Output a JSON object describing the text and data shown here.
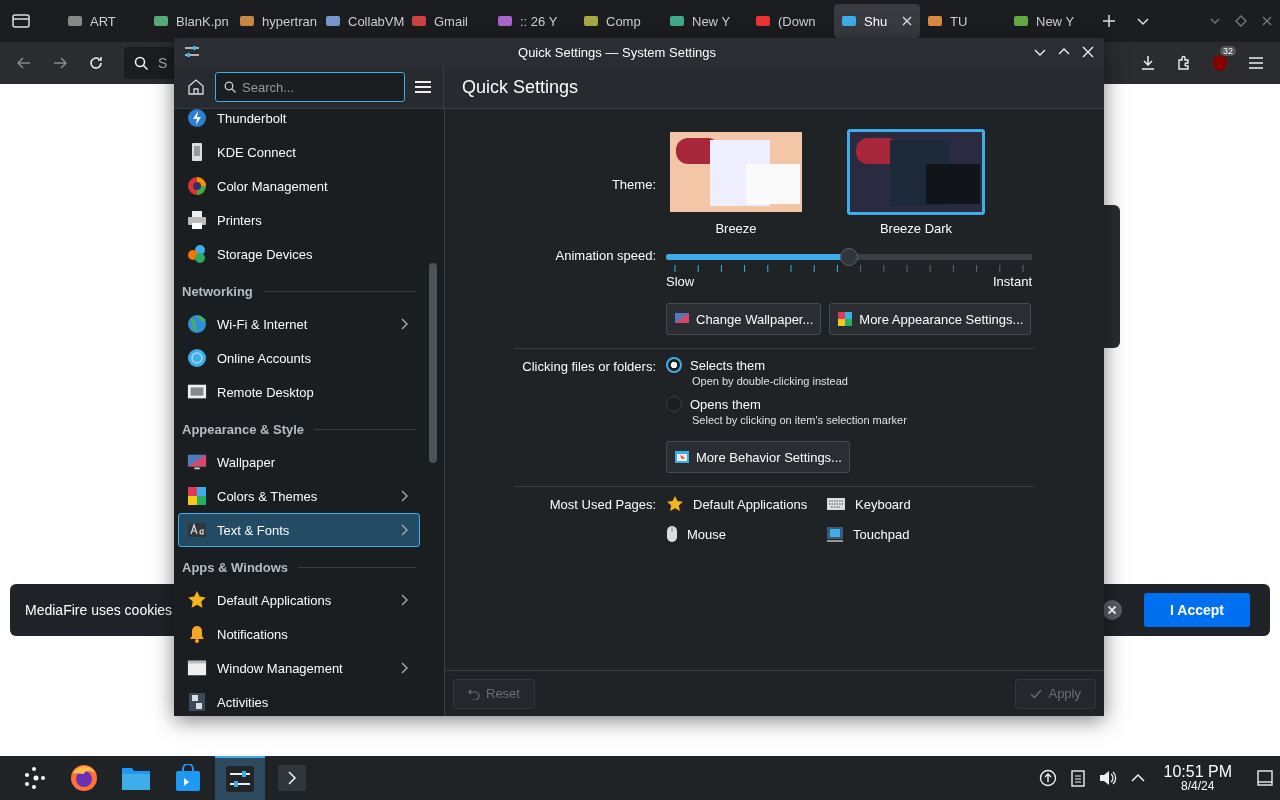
{
  "browser": {
    "tabs": [
      {
        "label": "ART",
        "selected": false
      },
      {
        "label": "BlanK.pn",
        "selected": false
      },
      {
        "label": "hypertran",
        "selected": false
      },
      {
        "label": "CollabVM",
        "selected": false
      },
      {
        "label": "Gmail",
        "selected": false
      },
      {
        "label": ":: 26 Y",
        "selected": false
      },
      {
        "label": "Comp",
        "selected": false
      },
      {
        "label": "New Y",
        "selected": false
      },
      {
        "label": "(Down",
        "selected": false
      },
      {
        "label": "Shu",
        "selected": true
      },
      {
        "label": "TU",
        "selected": false
      },
      {
        "label": "New Y",
        "selected": false
      }
    ],
    "address": {
      "placeholder": "S"
    },
    "extension_badge": "32"
  },
  "page": {
    "cookie_banner": {
      "text": "MediaFire uses cookies",
      "button": "I Accept"
    }
  },
  "window": {
    "title": "Quick Settings — System Settings",
    "search": {
      "placeholder": "Search..."
    },
    "page_title": "Quick Settings",
    "sidebar": {
      "items": [
        {
          "kind": "item",
          "label": "Thunderbolt",
          "arrow": false,
          "selected": false
        },
        {
          "kind": "item",
          "label": "KDE Connect",
          "arrow": false,
          "selected": false
        },
        {
          "kind": "item",
          "label": "Color Management",
          "arrow": false,
          "selected": false
        },
        {
          "kind": "item",
          "label": "Printers",
          "arrow": false,
          "selected": false
        },
        {
          "kind": "item",
          "label": "Storage Devices",
          "arrow": false,
          "selected": false
        },
        {
          "kind": "section",
          "label": "Networking"
        },
        {
          "kind": "item",
          "label": "Wi-Fi & Internet",
          "arrow": true,
          "selected": false
        },
        {
          "kind": "item",
          "label": "Online Accounts",
          "arrow": false,
          "selected": false
        },
        {
          "kind": "item",
          "label": "Remote Desktop",
          "arrow": false,
          "selected": false
        },
        {
          "kind": "section",
          "label": "Appearance & Style"
        },
        {
          "kind": "item",
          "label": "Wallpaper",
          "arrow": false,
          "selected": false
        },
        {
          "kind": "item",
          "label": "Colors & Themes",
          "arrow": true,
          "selected": false
        },
        {
          "kind": "item",
          "label": "Text & Fonts",
          "arrow": true,
          "selected": true
        },
        {
          "kind": "section",
          "label": "Apps & Windows"
        },
        {
          "kind": "item",
          "label": "Default Applications",
          "arrow": true,
          "selected": false
        },
        {
          "kind": "item",
          "label": "Notifications",
          "arrow": false,
          "selected": false
        },
        {
          "kind": "item",
          "label": "Window Management",
          "arrow": true,
          "selected": false
        },
        {
          "kind": "item",
          "label": "Activities",
          "arrow": false,
          "selected": false
        }
      ]
    },
    "theme": {
      "label": "Theme:",
      "options": [
        {
          "name": "Breeze",
          "selected": false
        },
        {
          "name": "Breeze Dark",
          "selected": true
        }
      ]
    },
    "animation": {
      "label": "Animation speed:",
      "level": 0.5,
      "min_label": "Slow",
      "max_label": "Instant"
    },
    "appearance_buttons": [
      "Change Wallpaper...",
      "More Appearance Settings..."
    ],
    "clicking": {
      "label": "Clicking files or folders:",
      "options": [
        {
          "label": "Selects them",
          "hint": "Open by double-clicking instead",
          "selected": true
        },
        {
          "label": "Opens them",
          "hint": "Select by clicking on item's selection marker",
          "selected": false
        }
      ]
    },
    "behavior_button": "More Behavior Settings...",
    "most_used": {
      "label": "Most Used Pages:",
      "items": [
        "Default Applications",
        "Keyboard",
        "Mouse",
        "Touchpad"
      ]
    },
    "footer": {
      "reset": {
        "label": "Reset",
        "disabled": true
      },
      "apply": {
        "label": "Apply",
        "disabled": true
      }
    }
  },
  "taskbar": {
    "tasks": [
      {
        "selected": false
      },
      {
        "selected": false
      },
      {
        "selected": false
      },
      {
        "selected": true
      },
      {
        "selected": false
      }
    ],
    "time": "10:51 PM",
    "date": "8/4/24"
  }
}
